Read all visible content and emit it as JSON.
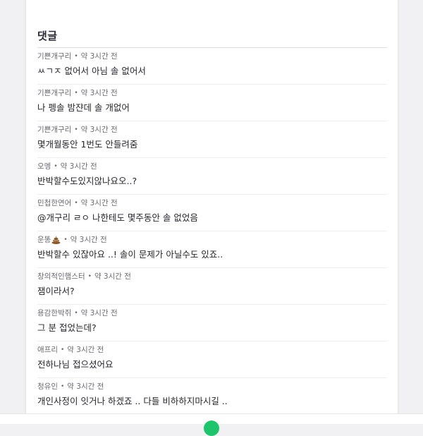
{
  "section": {
    "title": "댓글"
  },
  "comments": [
    {
      "author": "기쁜개구리",
      "time": "약 3시간 전",
      "text": "ㅆㄱㅈ 없어서 아님 솔 없어서",
      "has_icon": false
    },
    {
      "author": "기쁜개구리",
      "time": "약 3시간 전",
      "text": "나 펭솔 밤쟌데 솔 개없어",
      "has_icon": false
    },
    {
      "author": "기쁜개구리",
      "time": "약 3시간 전",
      "text": "몇개월동안 1번도 안들려줌",
      "has_icon": false
    },
    {
      "author": "오멩",
      "time": "약 3시간 전",
      "text": "반박할수도있지않나요오..?",
      "has_icon": false
    },
    {
      "author": "민첩한연어",
      "time": "약 3시간 전",
      "text": "@개구리 ㄹㅇ 나한테도 몇주동안 솔 없었음",
      "has_icon": false
    },
    {
      "author": "운똥",
      "time": "약 3시간 전",
      "text": "반박할수 있잖아요 ..! 솔이 문제가 아닐수도 있죠..",
      "has_icon": true,
      "icon": "poop-icon"
    },
    {
      "author": "창의적인햄스터",
      "time": "약 3시간 전",
      "text": "잼이라서?",
      "has_icon": false
    },
    {
      "author": "용감한박쥐",
      "time": "약 3시간 전",
      "text": "그 분 접었는데?",
      "has_icon": false
    },
    {
      "author": "애프리",
      "time": "약 3시간 전",
      "text": "전하나님 접으셨어요",
      "has_icon": false
    },
    {
      "author": "청유인",
      "time": "약 3시간 전",
      "text": "개인사정이 잇거나 하겠죠 .. 다들 비하하지마시길 ..",
      "has_icon": false
    }
  ],
  "meta_separator": "•",
  "colors": {
    "background": "#f1f1f3",
    "card": "#ffffff",
    "accent_green": "#1ec46b",
    "poop": "#8a5a2b"
  }
}
